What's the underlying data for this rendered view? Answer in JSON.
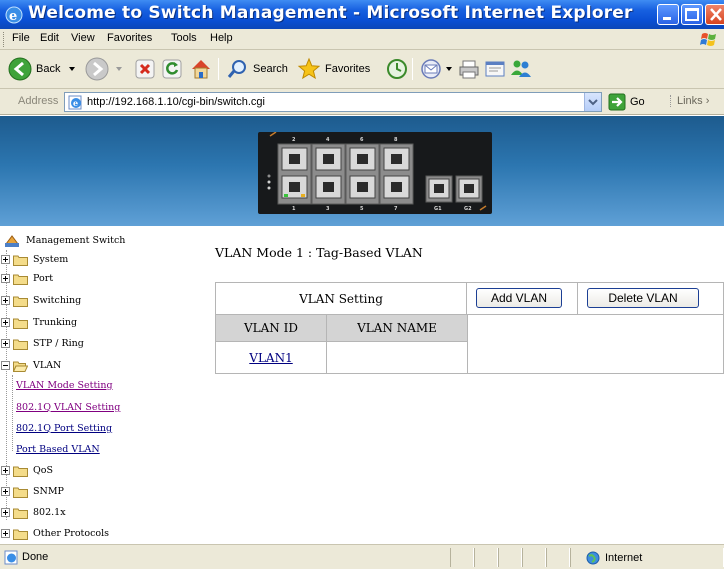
{
  "window": {
    "title": "Welcome to Switch Management - Microsoft Internet Explorer"
  },
  "menu": [
    "File",
    "Edit",
    "View",
    "Favorites",
    "Tools",
    "Help"
  ],
  "toolbar": {
    "back_label": "Back",
    "search_label": "Search",
    "favorites_label": "Favorites"
  },
  "address": {
    "label": "Address",
    "url": "http://192.168.1.10/cgi-bin/switch.cgi",
    "go_label": "Go",
    "links_label": "Links"
  },
  "banner": {
    "port_numbers_top": [
      "2",
      "4",
      "6",
      "8"
    ],
    "port_numbers_bottom": [
      "1",
      "3",
      "5",
      "7",
      "G1",
      "G2"
    ]
  },
  "tree": {
    "root_label": "Management Switch",
    "items": [
      {
        "label": "System",
        "expanded": false
      },
      {
        "label": "Port",
        "expanded": false
      },
      {
        "label": "Switching",
        "expanded": false
      },
      {
        "label": "Trunking",
        "expanded": false
      },
      {
        "label": "STP / Ring",
        "expanded": false
      },
      {
        "label": "VLAN",
        "expanded": true
      },
      {
        "label": "QoS",
        "expanded": false
      },
      {
        "label": "SNMP",
        "expanded": false
      },
      {
        "label": "802.1x",
        "expanded": false
      },
      {
        "label": "Other Protocols",
        "expanded": false
      }
    ],
    "vlan_children": [
      "VLAN Mode Setting",
      "802.1Q VLAN Setting",
      "802.1Q Port Setting",
      "Port Based VLAN"
    ]
  },
  "main": {
    "mode_title": "VLAN Mode 1 : Tag-Based VLAN",
    "setting_label": "VLAN Setting",
    "add_button": "Add VLAN",
    "delete_button": "Delete VLAN",
    "col_id": "VLAN ID",
    "col_name": "VLAN NAME",
    "rows": [
      {
        "id": "VLAN1",
        "name": ""
      }
    ]
  },
  "status": {
    "text": "Done",
    "zone": "Internet"
  },
  "colors": {
    "titlebar": "#0a4fd4",
    "chrome": "#ece9d8",
    "link_visited": "#800080",
    "link": "#000080",
    "header_cell": "#d4d4d4",
    "button_border": "#1c3f94"
  }
}
